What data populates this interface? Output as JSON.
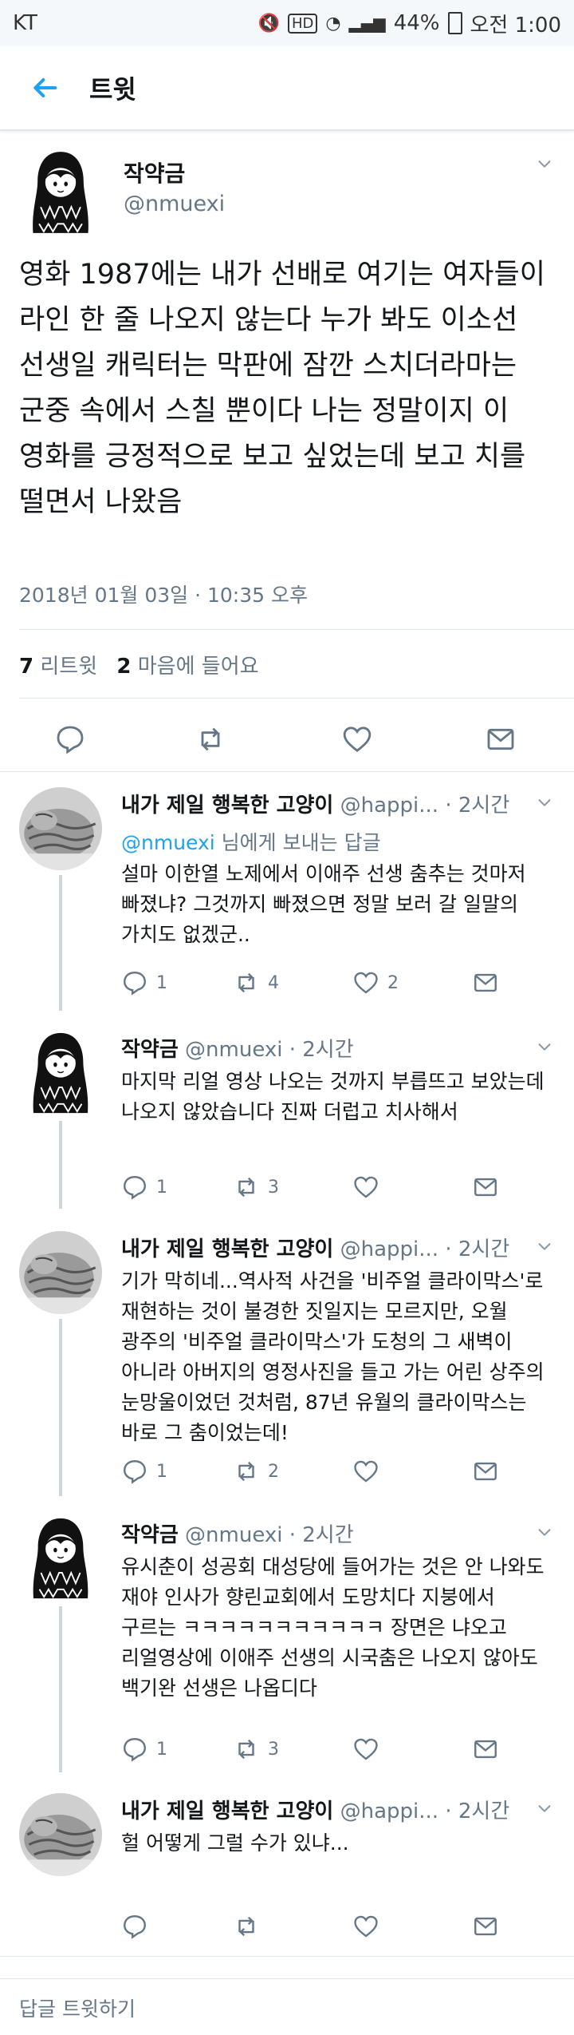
{
  "statusbar": {
    "carrier": "KT",
    "indicators": "HD",
    "battery": "44%",
    "time": "오전 1:00"
  },
  "header": {
    "title": "트윗"
  },
  "main_tweet": {
    "name": "작약금",
    "handle": "@nmuexi",
    "text": "영화 1987에는 내가 선배로 여기는 여자들이 라인 한 줄 나오지 않는다 누가 봐도 이소선 선생일 캐릭터는 막판에 잠깐 스치더라마는 군중 속에서 스칠 뿐이다 나는 정말이지 이 영화를 긍정적으로 보고 싶었는데 보고 치를 떨면서 나왔음",
    "timestamp": "2018년 01월 03일 · 10:35 오후",
    "retweets": "7",
    "retweets_label": "리트윗",
    "likes": "2",
    "likes_label": "마음에 들어요"
  },
  "replies": [
    {
      "name": "내가 제일 행복한 고양이",
      "handle": "@happi...",
      "time": "· 2시간",
      "to_mention": "@nmuexi",
      "to_suffix": " 님에게 보내는 답글",
      "text": "설마 이한열 노제에서 이애주 선생 춤추는 것마저 빠졌냐? 그것까지 빠졌으면 정말 보러 갈 일말의 가치도 없겠군..",
      "reply_count": "1",
      "retweet_count": "4",
      "like_count": "2"
    },
    {
      "name": "작약금",
      "handle": "@nmuexi",
      "time": "· 2시간",
      "text": "마지막 리얼 영상 나오는 것까지 부릅뜨고 보았는데 나오지 않았습니다 진짜 더럽고 치사해서",
      "reply_count": "1",
      "retweet_count": "3",
      "like_count": ""
    },
    {
      "name": "내가 제일 행복한 고양이",
      "handle": "@happi...",
      "time": "· 2시간",
      "text": "기가 막히네...역사적 사건을 '비주얼 클라이막스'로 재현하는 것이 불경한 짓일지는 모르지만, 오월 광주의 '비주얼 클라이막스'가 도청의 그 새벽이 아니라 아버지의 영정사진을 들고 가는 어린 상주의 눈망울이었던 것처럼, 87년 유월의 클라이막스는 바로 그 춤이었는데!",
      "reply_count": "1",
      "retweet_count": "2",
      "like_count": ""
    },
    {
      "name": "작약금",
      "handle": "@nmuexi",
      "time": "· 2시간",
      "text": "유시춘이 성공회 대성당에 들어가는 것은 안 나와도 재야 인사가 향린교회에서 도망치다 지붕에서 구르는 ㅋㅋㅋㅋㅋㅋㅋㅋㅋㅋㅋ 장면은 냐오고 리얼영상에 이애주 선생의 시국춤은 나오지 않아도 백기완 선생은 나옵디다",
      "reply_count": "1",
      "retweet_count": "3",
      "like_count": ""
    },
    {
      "name": "내가 제일 행복한 고양이",
      "handle": "@happi...",
      "time": "· 2시간",
      "text": "헐 어떻게 그럴 수가 있냐...",
      "reply_count": "",
      "retweet_count": "",
      "like_count": ""
    }
  ],
  "compose": {
    "placeholder": "답글 트윗하기"
  },
  "colors": {
    "accent": "#1da1f2",
    "muted": "#657786",
    "text": "#14171a",
    "divider": "#e1e8ed"
  },
  "icons": [
    "back-arrow-icon",
    "reply-icon",
    "retweet-icon",
    "like-icon",
    "message-icon",
    "chevron-down-icon"
  ]
}
